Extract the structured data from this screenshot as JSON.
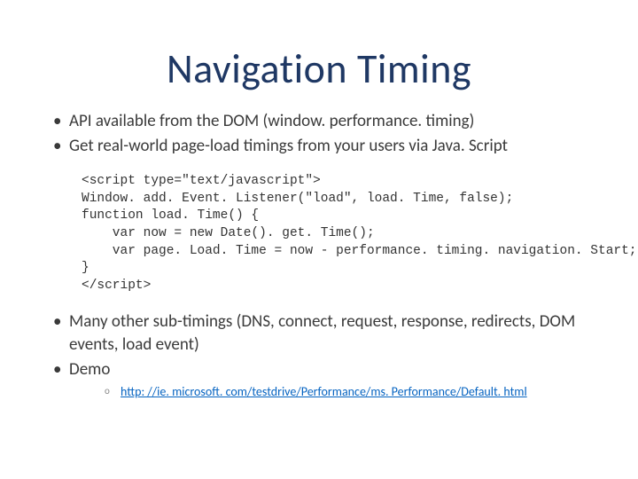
{
  "title": "Navigation Timing",
  "bullets": {
    "b1": "API available from the DOM (window. performance. timing)",
    "b2": "Get real-world page-load timings from your users via Java. Script",
    "b3": "Many other sub-timings (DNS, connect, request, response, redirects, DOM events, load event)",
    "b4": "Demo"
  },
  "code": "<script type=\"text/javascript\">\nWindow. add. Event. Listener(\"load\", load. Time, false);\nfunction load. Time() {\n    var now = new Date(). get. Time();\n    var page. Load. Time = now - performance. timing. navigation. Start;\n}\n</script>",
  "demo": {
    "url_text": "http: //ie. microsoft. com/testdrive/Performance/ms. Performance/Default. html",
    "href": "http://ie.microsoft.com/testdrive/Performance/ms.Performance/Default.html"
  }
}
